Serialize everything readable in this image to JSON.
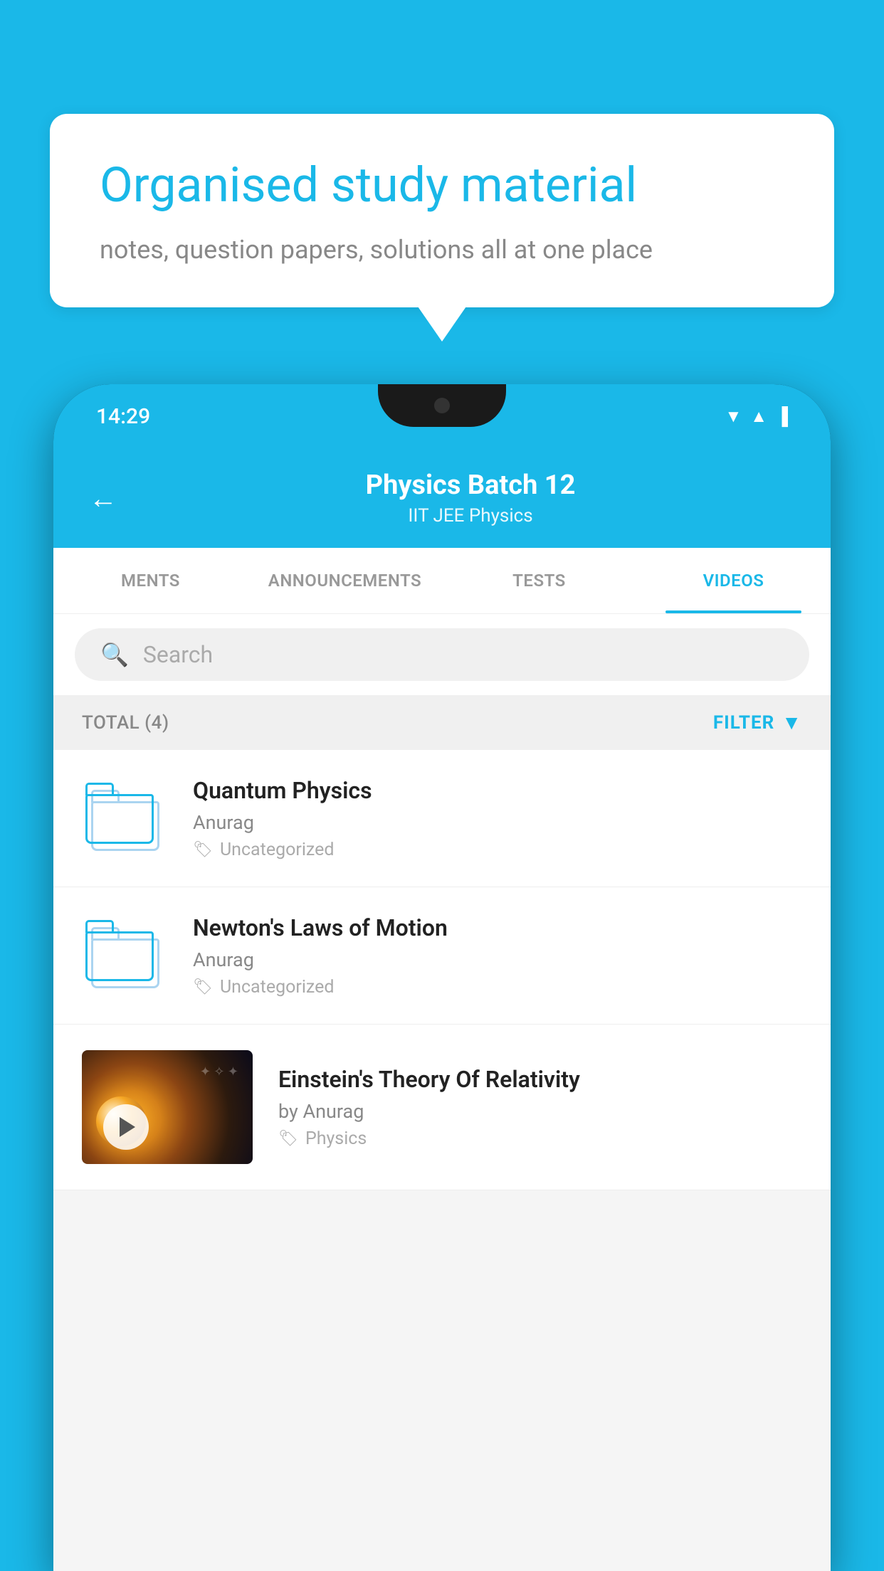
{
  "background": {
    "color": "#1ab8e8"
  },
  "speech_bubble": {
    "title": "Organised study material",
    "subtitle": "notes, question papers, solutions all at one place"
  },
  "phone": {
    "status_bar": {
      "time": "14:29",
      "icons": [
        "wifi",
        "signal",
        "battery"
      ]
    },
    "header": {
      "back_label": "←",
      "title": "Physics Batch 12",
      "subtitle": "IIT JEE   Physics"
    },
    "tabs": [
      {
        "label": "MENTS",
        "active": false
      },
      {
        "label": "ANNOUNCEMENTS",
        "active": false
      },
      {
        "label": "TESTS",
        "active": false
      },
      {
        "label": "VIDEOS",
        "active": true
      }
    ],
    "search": {
      "placeholder": "Search"
    },
    "filter_row": {
      "total_label": "TOTAL (4)",
      "filter_label": "FILTER"
    },
    "videos": [
      {
        "title": "Quantum Physics",
        "author": "Anurag",
        "tag": "Uncategorized",
        "type": "folder"
      },
      {
        "title": "Newton's Laws of Motion",
        "author": "Anurag",
        "tag": "Uncategorized",
        "type": "folder"
      },
      {
        "title": "Einstein's Theory Of Relativity",
        "author": "by Anurag",
        "tag": "Physics",
        "type": "video"
      }
    ]
  }
}
